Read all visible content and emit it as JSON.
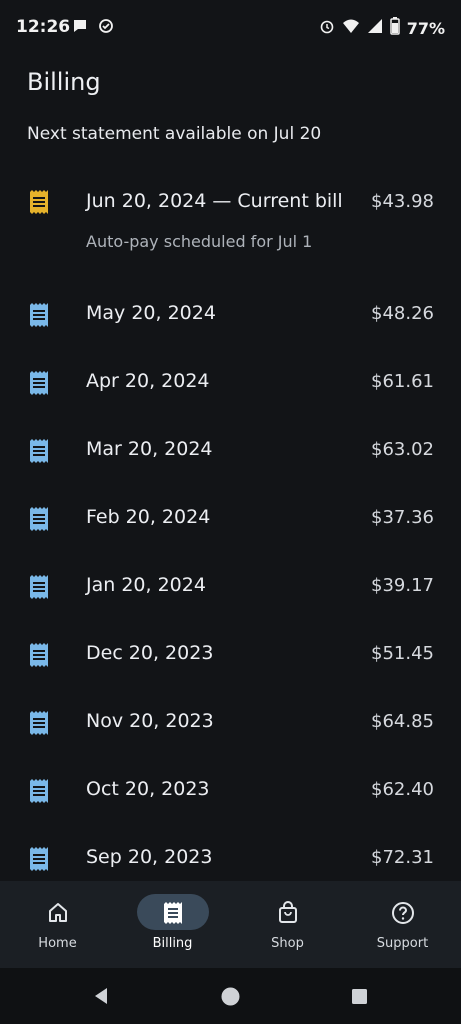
{
  "status_bar": {
    "time": "12:26",
    "battery": "77%",
    "icons": [
      "message-icon",
      "check-circle-icon",
      "alarm-icon",
      "wifi-icon",
      "signal-icon",
      "battery-icon"
    ]
  },
  "page": {
    "title": "Billing",
    "subtitle": "Next statement available on Jul 20"
  },
  "colors": {
    "background": "#121417",
    "current_bill_icon": "#e5b22b",
    "bill_icon": "#7ab8e8",
    "nav_active_pill": "#3a4a5a"
  },
  "bills": [
    {
      "date": "Jun 20, 2024 — Current bill",
      "amount": "$43.98",
      "note": "Auto-pay scheduled for Jul 1",
      "current": true
    },
    {
      "date": "May 20, 2024",
      "amount": "$48.26"
    },
    {
      "date": "Apr 20, 2024",
      "amount": "$61.61"
    },
    {
      "date": "Mar 20, 2024",
      "amount": "$63.02"
    },
    {
      "date": "Feb 20, 2024",
      "amount": "$37.36"
    },
    {
      "date": "Jan 20, 2024",
      "amount": "$39.17"
    },
    {
      "date": "Dec 20, 2023",
      "amount": "$51.45"
    },
    {
      "date": "Nov 20, 2023",
      "amount": "$64.85"
    },
    {
      "date": "Oct 20, 2023",
      "amount": "$62.40"
    },
    {
      "date": "Sep 20, 2023",
      "amount": "$72.31"
    }
  ],
  "bottom_nav": [
    {
      "label": "Home",
      "icon": "home-icon"
    },
    {
      "label": "Billing",
      "icon": "receipt-icon",
      "active": true
    },
    {
      "label": "Shop",
      "icon": "shopping-bag-icon"
    },
    {
      "label": "Support",
      "icon": "help-icon"
    }
  ],
  "system_nav": [
    "back-button",
    "home-button",
    "recents-button"
  ]
}
